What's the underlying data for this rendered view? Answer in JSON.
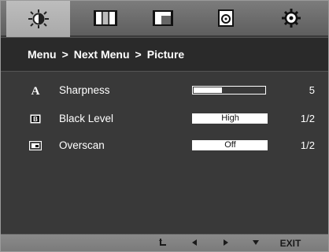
{
  "tabs": [
    {
      "name": "picture",
      "icon": "brightness-icon",
      "active": true
    },
    {
      "name": "color",
      "icon": "color-icon",
      "active": false
    },
    {
      "name": "display",
      "icon": "display-icon",
      "active": false
    },
    {
      "name": "audio",
      "icon": "audio-icon",
      "active": false
    },
    {
      "name": "settings",
      "icon": "gear-icon",
      "active": false
    }
  ],
  "breadcrumb": {
    "level1": "Menu",
    "sep": ">",
    "level2": "Next Menu",
    "level3": "Picture"
  },
  "settings": [
    {
      "icon": "sharpness-icon",
      "label": "Sharpness",
      "value": "5",
      "level_fraction": 0.4,
      "option": ""
    },
    {
      "icon": "black-level-icon",
      "label": "Black Level",
      "value": "1/2",
      "option": "High"
    },
    {
      "icon": "overscan-icon",
      "label": "Overscan",
      "value": "1/2",
      "option": "Off"
    }
  ],
  "footer": {
    "enter_icon": "enter-icon",
    "left_icon": "left-arrow-icon",
    "right_icon": "right-arrow-icon",
    "down_icon": "down-arrow-icon",
    "exit_label": "EXIT"
  },
  "colors": {
    "osd_bg": "#393939",
    "active_tab": "#b3b3b3",
    "text": "#ffffff"
  }
}
